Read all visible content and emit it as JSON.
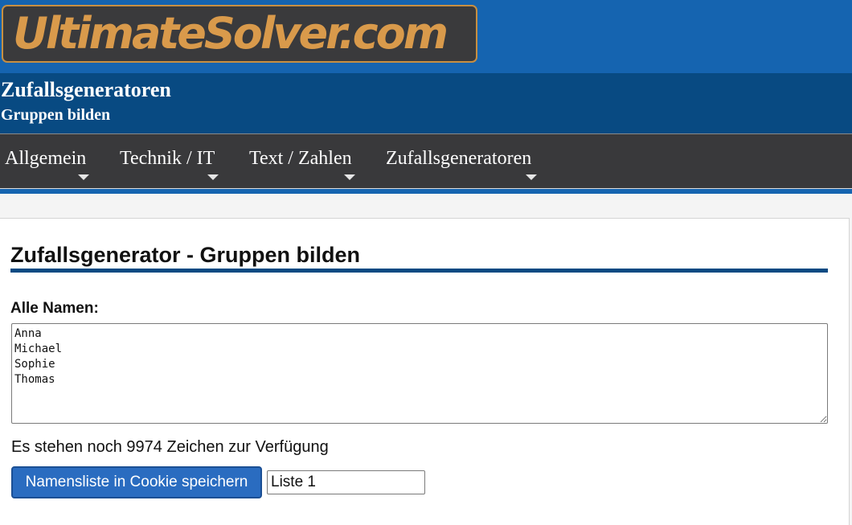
{
  "header": {
    "logo_text": "UltimateSolver.com",
    "site_title": "Zufallsgeneratoren",
    "site_subtitle": "Gruppen bilden"
  },
  "nav": {
    "items": [
      {
        "label": "Allgemein",
        "icon": "caret-down-icon"
      },
      {
        "label": "Technik / IT",
        "icon": "caret-down-icon"
      },
      {
        "label": "Text / Zahlen",
        "icon": "caret-down-icon"
      },
      {
        "label": "Zufallsgeneratoren",
        "icon": "caret-down-icon"
      }
    ]
  },
  "main": {
    "heading": "Zufallsgenerator - Gruppen bilden",
    "names_label": "Alle Namen:",
    "names_value": "Anna\nMichael\nSophie\nThomas",
    "chars_left_text": "Es stehen noch 9974 Zeichen zur Verfügung",
    "save_button_label": "Namensliste in Cookie speichern",
    "list_name_value": "Liste 1"
  },
  "colors": {
    "topbar": "#1564b0",
    "titlebar": "#084a82",
    "navbar": "#39393b",
    "logo_text": "#d99a4b",
    "logo_border": "#c78f42",
    "button": "#2a6cc0"
  }
}
